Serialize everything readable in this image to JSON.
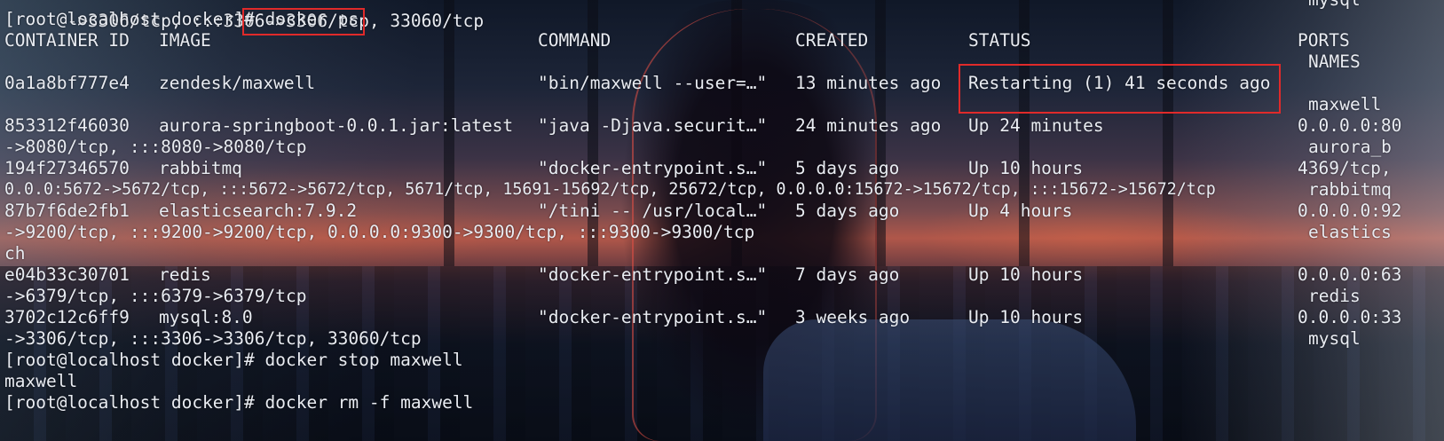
{
  "top_partial": "->3306/tcp, :::3306->3306/tcp, 33060/tcp",
  "top_partial_right": "mysql",
  "prompt": "[root@localhost docker]# ",
  "cmd_ps": "docker ps",
  "headers": {
    "container_id": "CONTAINER ID",
    "image": "IMAGE",
    "command": "COMMAND",
    "created": "CREATED",
    "status": "STATUS",
    "ports": "PORTS",
    "names": "NAMES"
  },
  "rows": [
    {
      "id": "0a1a8bf777e4",
      "image": "zendesk/maxwell",
      "command": "\"bin/maxwell --user=…\"",
      "created": "13 minutes ago",
      "status": "Restarting (1) 41 seconds ago",
      "ports": "",
      "ports_cont": "",
      "ports_cont2": "",
      "name": "maxwell"
    },
    {
      "id": "853312f46030",
      "image": "aurora-springboot-0.0.1.jar:latest",
      "command": "\"java -Djava.securit…\"",
      "created": "24 minutes ago",
      "status": "Up 24 minutes",
      "ports": "0.0.0.0:80",
      "ports_cont": "->8080/tcp, :::8080->8080/tcp",
      "name": "aurora_b"
    },
    {
      "id": "194f27346570",
      "image": "rabbitmq",
      "command": "\"docker-entrypoint.s…\"",
      "created": "5 days ago",
      "status": "Up 10 hours",
      "ports": "4369/tcp,",
      "ports_cont": "0.0.0:5672->5672/tcp, :::5672->5672/tcp, 5671/tcp, 15691-15692/tcp, 25672/tcp, 0.0.0.0:15672->15672/tcp, :::15672->15672/tcp",
      "name": "rabbitmq"
    },
    {
      "id": "87b7f6de2fb1",
      "image": "elasticsearch:7.9.2",
      "command": "\"/tini -- /usr/local…\"",
      "created": "5 days ago",
      "status": "Up 4 hours",
      "ports": "0.0.0.0:92",
      "ports_cont": "->9200/tcp, :::9200->9200/tcp, 0.0.0.0:9300->9300/tcp, :::9300->9300/tcp",
      "ports_cont2": "ch",
      "name": "elastics"
    },
    {
      "id": "e04b33c30701",
      "image": "redis",
      "command": "\"docker-entrypoint.s…\"",
      "created": "7 days ago",
      "status": "Up 10 hours",
      "ports": "0.0.0.0:63",
      "ports_cont": "->6379/tcp, :::6379->6379/tcp",
      "name": "redis"
    },
    {
      "id": "3702c12c6ff9",
      "image": "mysql:8.0",
      "command": "\"docker-entrypoint.s…\"",
      "created": "3 weeks ago",
      "status": "Up 10 hours",
      "ports": "0.0.0.0:33",
      "ports_cont": "->3306/tcp, :::3306->3306/tcp, 33060/tcp",
      "name": "mysql"
    }
  ],
  "cmd_stop": "docker stop maxwell",
  "stop_output": "maxwell",
  "cmd_rm": "docker rm -f maxwell",
  "colors": {
    "text": "#e9ecf2",
    "highlight": "#e02a2a"
  }
}
